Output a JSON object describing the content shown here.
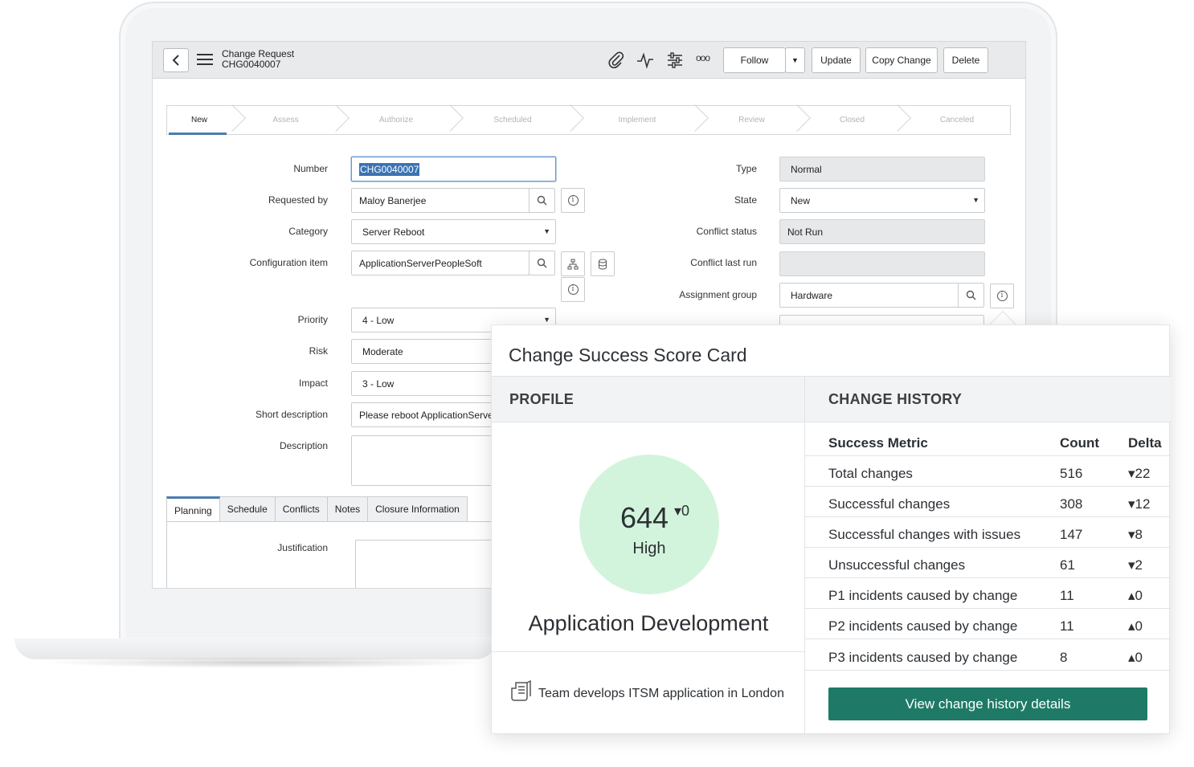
{
  "header": {
    "record_type": "Change Request",
    "record_number": "CHG0040007",
    "follow_label": "Follow",
    "update_label": "Update",
    "copy_change_label": "Copy Change",
    "delete_label": "Delete",
    "more_label": "ooo"
  },
  "flow": {
    "steps": [
      "New",
      "Assess",
      "Authorize",
      "Scheduled",
      "Implement",
      "Review",
      "Closed",
      "Canceled"
    ],
    "active": "New"
  },
  "form": {
    "number": {
      "label": "Number",
      "value": "CHG0040007"
    },
    "requested_by": {
      "label": "Requested by",
      "value": "Maloy Banerjee"
    },
    "category": {
      "label": "Category",
      "value": "Server Reboot"
    },
    "configuration_item": {
      "label": "Configuration item",
      "value": "ApplicationServerPeopleSoft"
    },
    "priority": {
      "label": "Priority",
      "value": "4 - Low"
    },
    "risk": {
      "label": "Risk",
      "value": "Moderate"
    },
    "impact": {
      "label": "Impact",
      "value": "3 - Low"
    },
    "short_description": {
      "label": "Short description",
      "value": "Please reboot ApplicationServe"
    },
    "description": {
      "label": "Description",
      "value": ""
    },
    "type": {
      "label": "Type",
      "value": "Normal"
    },
    "state": {
      "label": "State",
      "value": "New"
    },
    "conflict_status": {
      "label": "Conflict status",
      "value": "Not Run"
    },
    "conflict_last_run": {
      "label": "Conflict last run",
      "value": ""
    },
    "assignment_group": {
      "label": "Assignment group",
      "value": "Hardware"
    },
    "justification": {
      "label": "Justification"
    }
  },
  "tabs": [
    "Planning",
    "Schedule",
    "Conflicts",
    "Notes",
    "Closure Information"
  ],
  "scorecard": {
    "title": "Change Success Score Card",
    "profile_heading": "PROFILE",
    "history_heading": "CHANGE HISTORY",
    "score": "644",
    "score_delta": "▾0",
    "score_level": "High",
    "team_name": "Application Development",
    "team_description": "Team develops ITSM application in London",
    "columns": [
      "Success Metric",
      "Count",
      "Delta"
    ],
    "metrics": [
      {
        "name": "Total changes",
        "count": "516",
        "delta": "▾22"
      },
      {
        "name": "Successful changes",
        "count": "308",
        "delta": "▾12"
      },
      {
        "name": "Successful changes with issues",
        "count": "147",
        "delta": "▾8"
      },
      {
        "name": "Unsuccessful changes",
        "count": "61",
        "delta": "▾2"
      },
      {
        "name": "P1 incidents caused by change",
        "count": "11",
        "delta": "▴0"
      },
      {
        "name": "P2 incidents caused by change",
        "count": "11",
        "delta": "▴0"
      },
      {
        "name": "P3 incidents caused by change",
        "count": "8",
        "delta": "▴0"
      }
    ],
    "button_label": "View change history details",
    "button_color": "#1e7a66",
    "score_circle_color": "#d3f4dc"
  }
}
